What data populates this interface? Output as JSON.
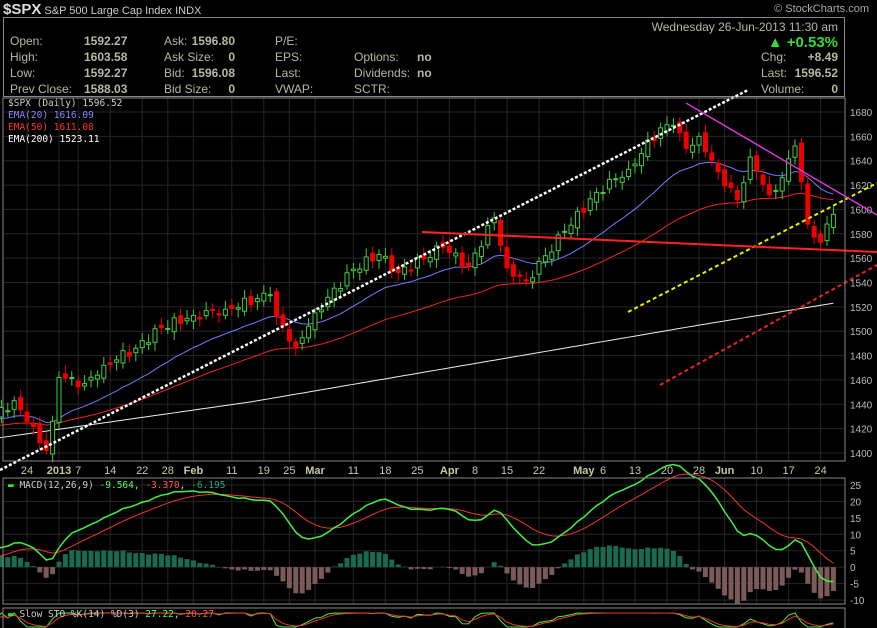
{
  "header": {
    "symbol": "$SPX",
    "name": "S&P 500 Large Cap Index",
    "exchange": "INDX",
    "brand": "© StockCharts.com"
  },
  "quote": {
    "datetime": "Wednesday  26-Jun-2013  11:30 am",
    "pct": "+0.53%",
    "up_color": "#33cc33",
    "open_l": "Open:",
    "open": "1592.27",
    "high_l": "High:",
    "high": "1603.58",
    "low_l": "Low:",
    "low": "1592.27",
    "prev_l": "Prev Close:",
    "prev": "1588.03",
    "ask_l": "Ask:",
    "ask": "1596.80",
    "asksize_l": "Ask Size:",
    "asksize": "0",
    "bid_l": "Bid:",
    "bid": "1596.08",
    "bidsize_l": "Bid Size:",
    "bidsize": "0",
    "pe_l": "P/E:",
    "eps_l": "EPS:",
    "last2_l": "Last:",
    "vwap_l": "VWAP:",
    "options_l": "Options:",
    "options": "no",
    "div_l": "Dividends:",
    "div": "no",
    "sctr_l": "SCTR:",
    "chg_l": "Chg:",
    "chg": "+8.49",
    "last_l": "Last:",
    "last": "1596.52",
    "vol_l": "Volume:",
    "vol": "0"
  },
  "legend": {
    "price": "$SPX (Daily) 1596.52",
    "ema20": "EMA(20) 1616.09",
    "ema50": "EMA(50) 1611.08",
    "ema200": "EMA(200) 1523.11"
  },
  "macd": {
    "label": "MACD(12,26,9)",
    "v1": "-9.564",
    "v2": "-3.370",
    "v3": "-6.195",
    "ticks": [
      "25",
      "20",
      "15",
      "10",
      "5",
      "0",
      "-5",
      "-10"
    ]
  },
  "sto": {
    "label": "Slow STO %K(14) %D(3)",
    "k": "27.22",
    "d": "20.27"
  },
  "chart_data": {
    "type": "candlestick",
    "title": "$SPX (Daily)",
    "ylim": [
      1400,
      1680
    ],
    "yticks": [
      "1680",
      "1660",
      "1640",
      "1620",
      "1600",
      "1580",
      "1560",
      "1540",
      "1520",
      "1500",
      "1480",
      "1460",
      "1440",
      "1420",
      "1400"
    ],
    "xticks": [
      {
        "t": "24",
        "i": 5
      },
      {
        "t": "2013",
        "i": 10,
        "b": 1
      },
      {
        "t": "7",
        "i": 13
      },
      {
        "t": "14",
        "i": 18
      },
      {
        "t": "22",
        "i": 23
      },
      {
        "t": "28",
        "i": 27
      },
      {
        "t": "Feb",
        "i": 31,
        "b": 1
      },
      {
        "t": "11",
        "i": 37
      },
      {
        "t": "19",
        "i": 42
      },
      {
        "t": "25",
        "i": 46
      },
      {
        "t": "Mar",
        "i": 50,
        "b": 1
      },
      {
        "t": "11",
        "i": 56
      },
      {
        "t": "18",
        "i": 61
      },
      {
        "t": "25",
        "i": 66
      },
      {
        "t": "Apr",
        "i": 71,
        "b": 1
      },
      {
        "t": "8",
        "i": 75
      },
      {
        "t": "15",
        "i": 80
      },
      {
        "t": "22",
        "i": 85
      },
      {
        "t": "May",
        "i": 92,
        "b": 1
      },
      {
        "t": "6",
        "i": 95
      },
      {
        "t": "13",
        "i": 100
      },
      {
        "t": "20",
        "i": 105
      },
      {
        "t": "28",
        "i": 110
      },
      {
        "t": "Jun",
        "i": 114,
        "b": 1
      },
      {
        "t": "10",
        "i": 119
      },
      {
        "t": "17",
        "i": 124
      },
      {
        "t": "24",
        "i": 129
      }
    ],
    "close_keyframes": [
      [
        0,
        1430
      ],
      [
        3,
        1443
      ],
      [
        5,
        1426
      ],
      [
        8,
        1402
      ],
      [
        9,
        1426
      ],
      [
        10,
        1462
      ],
      [
        14,
        1457
      ],
      [
        17,
        1472
      ],
      [
        22,
        1486
      ],
      [
        26,
        1503
      ],
      [
        31,
        1513
      ],
      [
        36,
        1518
      ],
      [
        43,
        1530
      ],
      [
        44,
        1512
      ],
      [
        47,
        1487
      ],
      [
        50,
        1515
      ],
      [
        56,
        1551
      ],
      [
        60,
        1563
      ],
      [
        63,
        1548
      ],
      [
        70,
        1569
      ],
      [
        74,
        1553
      ],
      [
        78,
        1593
      ],
      [
        80,
        1552
      ],
      [
        83,
        1541
      ],
      [
        89,
        1582
      ],
      [
        94,
        1614
      ],
      [
        99,
        1633
      ],
      [
        104,
        1667
      ],
      [
        106,
        1669
      ],
      [
        108,
        1650
      ],
      [
        110,
        1660
      ],
      [
        113,
        1631
      ],
      [
        116,
        1608
      ],
      [
        118,
        1643
      ],
      [
        121,
        1612
      ],
      [
        123,
        1626
      ],
      [
        125,
        1652
      ],
      [
        127,
        1588
      ],
      [
        129,
        1573
      ],
      [
        130,
        1588
      ],
      [
        131,
        1596
      ]
    ],
    "ema200_keyframes": [
      [
        0,
        1412
      ],
      [
        40,
        1442
      ],
      [
        80,
        1478
      ],
      [
        110,
        1505
      ],
      [
        131,
        1523
      ]
    ]
  }
}
